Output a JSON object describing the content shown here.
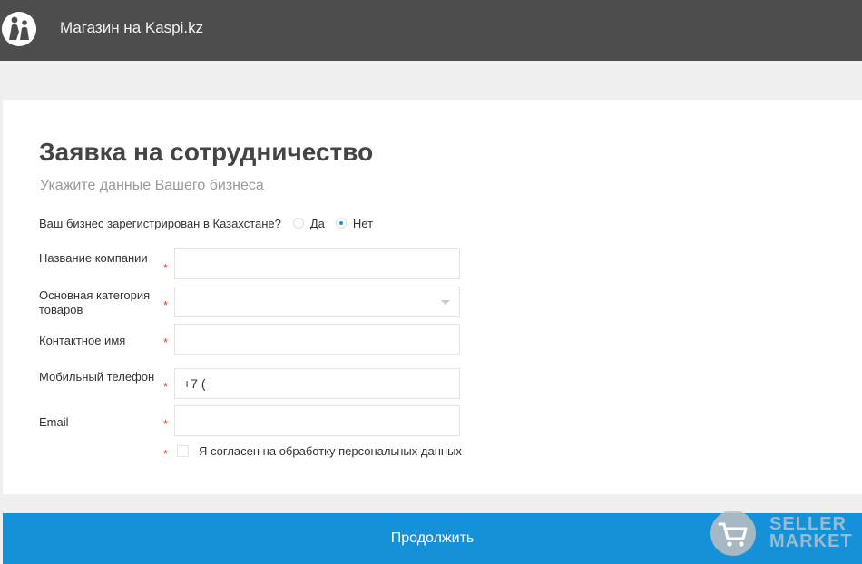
{
  "header": {
    "title": "Магазин на Kaspi.kz"
  },
  "form": {
    "title": "Заявка на сотрудничество",
    "subtitle": "Укажите данные Вашего бизнеса",
    "registered_question": "Ваш бизнес зарегистрирован в Казахстане?",
    "registered_options": [
      {
        "label": "Да",
        "selected": false
      },
      {
        "label": "Нет",
        "selected": true
      }
    ],
    "fields": {
      "company_name": {
        "label": "Название компании",
        "value": "",
        "required_mark": "*"
      },
      "category": {
        "label": "Основная категория товаров",
        "value": "",
        "required_mark": "*"
      },
      "contact_name": {
        "label": "Контактное имя",
        "value": "",
        "required_mark": "*"
      },
      "phone": {
        "label": "Мобильный телефон",
        "value": "+7 (",
        "required_mark": "*"
      },
      "email": {
        "label": "Email",
        "value": "",
        "required_mark": "*"
      }
    },
    "consent": {
      "label": "Я согласен на обработку персональных данных",
      "checked": false,
      "required_mark": "*"
    },
    "continue_label": "Продолжить"
  },
  "watermark": {
    "line1": "SELLER",
    "line2": "MARKET",
    "icon": "cart-icon"
  },
  "colors": {
    "header_bg": "#4d4d4d",
    "page_bg": "#efefef",
    "primary_button": "#1591da",
    "required": "#e53935",
    "radio_selected": "#1a8ee1"
  }
}
